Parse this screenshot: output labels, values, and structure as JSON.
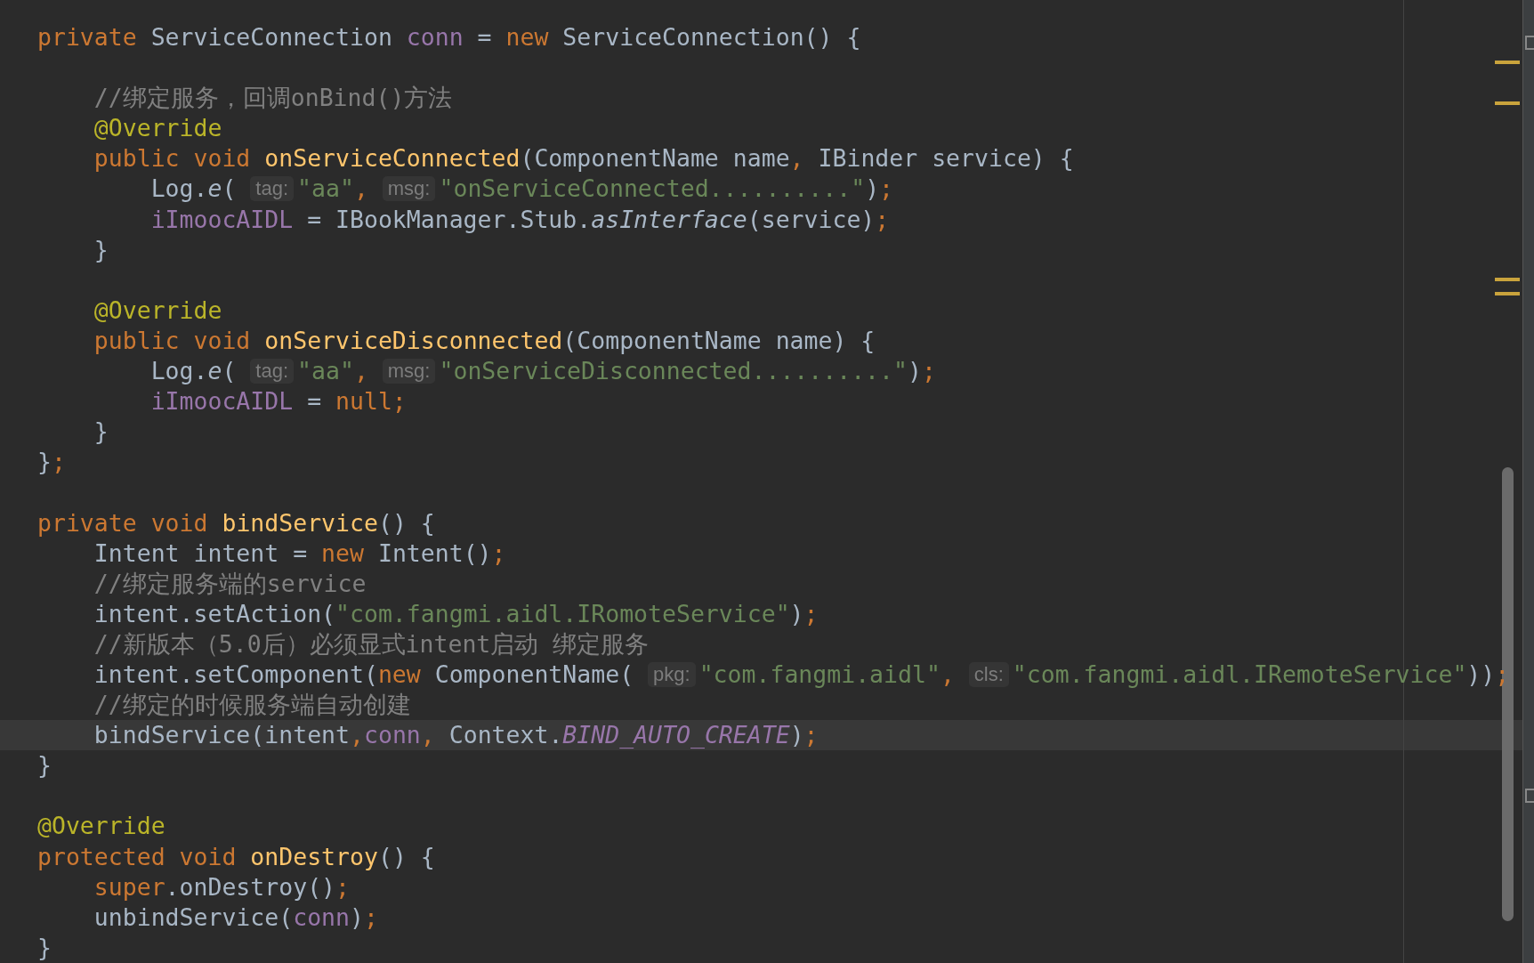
{
  "editor": {
    "lines": [
      {
        "kind": "code",
        "current": false,
        "tokens": [
          {
            "kind": "keyword",
            "text": "private "
          },
          {
            "kind": "plain",
            "text": "ServiceConnection "
          },
          {
            "kind": "field",
            "text": "conn"
          },
          {
            "kind": "plain",
            "text": " = "
          },
          {
            "kind": "keyword",
            "text": "new "
          },
          {
            "kind": "plain",
            "text": "ServiceConnection() {"
          }
        ],
        "children": [
          {
            "kind": "blank"
          },
          {
            "kind": "code",
            "current": false,
            "tokens": [
              {
                "kind": "comment",
                "text": "//绑定服务，回调onBind()方法"
              }
            ]
          },
          {
            "kind": "code",
            "current": false,
            "tokens": [
              {
                "kind": "annotation",
                "text": "@Override"
              }
            ]
          },
          {
            "kind": "code",
            "current": false,
            "tokens": [
              {
                "kind": "keyword",
                "text": "public void "
              },
              {
                "kind": "method",
                "text": "onServiceConnected"
              },
              {
                "kind": "plain",
                "text": "(ComponentName name"
              },
              {
                "kind": "keyword",
                "text": ", "
              },
              {
                "kind": "plain",
                "text": "IBinder service) {"
              }
            ],
            "children": [
              {
                "kind": "code",
                "current": false,
                "tokens": [
                  {
                    "kind": "plain",
                    "text": "Log."
                  },
                  {
                    "kind": "italic",
                    "text": "e"
                  },
                  {
                    "kind": "plain",
                    "text": "( "
                  },
                  {
                    "kind": "hint",
                    "text": "tag:"
                  },
                  {
                    "kind": "string",
                    "text": "\"aa\""
                  },
                  {
                    "kind": "keyword",
                    "text": ", "
                  },
                  {
                    "kind": "hint",
                    "text": "msg:"
                  },
                  {
                    "kind": "string",
                    "text": "\"onServiceConnected..........\""
                  },
                  {
                    "kind": "plain",
                    "text": ")"
                  },
                  {
                    "kind": "keyword",
                    "text": ";"
                  }
                ]
              },
              {
                "kind": "code",
                "current": false,
                "tokens": [
                  {
                    "kind": "field",
                    "text": "iImoocAIDL"
                  },
                  {
                    "kind": "plain",
                    "text": " = IBookManager.Stub."
                  },
                  {
                    "kind": "italic",
                    "text": "asInterface"
                  },
                  {
                    "kind": "plain",
                    "text": "(service)"
                  },
                  {
                    "kind": "keyword",
                    "text": ";"
                  }
                ]
              }
            ]
          },
          {
            "kind": "code",
            "current": false,
            "tokens": [
              {
                "kind": "plain",
                "text": "}"
              }
            ]
          },
          {
            "kind": "blank"
          },
          {
            "kind": "code",
            "current": false,
            "tokens": [
              {
                "kind": "annotation",
                "text": "@Override"
              }
            ]
          },
          {
            "kind": "code",
            "current": false,
            "tokens": [
              {
                "kind": "keyword",
                "text": "public void "
              },
              {
                "kind": "method",
                "text": "onServiceDisconnected"
              },
              {
                "kind": "plain",
                "text": "(ComponentName name) {"
              }
            ],
            "children": [
              {
                "kind": "code",
                "current": false,
                "tokens": [
                  {
                    "kind": "plain",
                    "text": "Log."
                  },
                  {
                    "kind": "italic",
                    "text": "e"
                  },
                  {
                    "kind": "plain",
                    "text": "( "
                  },
                  {
                    "kind": "hint",
                    "text": "tag:"
                  },
                  {
                    "kind": "string",
                    "text": "\"aa\""
                  },
                  {
                    "kind": "keyword",
                    "text": ", "
                  },
                  {
                    "kind": "hint",
                    "text": "msg:"
                  },
                  {
                    "kind": "string",
                    "text": "\"onServiceDisconnected..........\""
                  },
                  {
                    "kind": "plain",
                    "text": ")"
                  },
                  {
                    "kind": "keyword",
                    "text": ";"
                  }
                ]
              },
              {
                "kind": "code",
                "current": false,
                "tokens": [
                  {
                    "kind": "field",
                    "text": "iImoocAIDL"
                  },
                  {
                    "kind": "plain",
                    "text": " = "
                  },
                  {
                    "kind": "keyword",
                    "text": "null;"
                  }
                ]
              }
            ]
          },
          {
            "kind": "code",
            "current": false,
            "tokens": [
              {
                "kind": "plain",
                "text": "}"
              }
            ]
          }
        ]
      },
      {
        "kind": "code",
        "current": false,
        "tokens": [
          {
            "kind": "plain",
            "text": "}"
          },
          {
            "kind": "keyword",
            "text": ";"
          }
        ]
      },
      {
        "kind": "blank"
      },
      {
        "kind": "code",
        "current": false,
        "tokens": [
          {
            "kind": "keyword",
            "text": "private void "
          },
          {
            "kind": "method",
            "text": "bindService"
          },
          {
            "kind": "plain",
            "text": "() {"
          }
        ],
        "children": [
          {
            "kind": "code",
            "current": false,
            "tokens": [
              {
                "kind": "plain",
                "text": "Intent intent = "
              },
              {
                "kind": "keyword",
                "text": "new "
              },
              {
                "kind": "plain",
                "text": "Intent()"
              },
              {
                "kind": "keyword",
                "text": ";"
              }
            ]
          },
          {
            "kind": "code",
            "current": false,
            "tokens": [
              {
                "kind": "comment",
                "text": "//绑定服务端的service"
              }
            ]
          },
          {
            "kind": "code",
            "current": false,
            "tokens": [
              {
                "kind": "plain",
                "text": "intent.setAction("
              },
              {
                "kind": "string",
                "text": "\"com.fangmi.aidl.IRomoteService\""
              },
              {
                "kind": "plain",
                "text": ")"
              },
              {
                "kind": "keyword",
                "text": ";"
              }
            ]
          },
          {
            "kind": "code",
            "current": false,
            "tokens": [
              {
                "kind": "comment",
                "text": "//新版本（5.0后）必须显式intent启动 绑定服务"
              }
            ]
          },
          {
            "kind": "code",
            "current": false,
            "tokens": [
              {
                "kind": "plain",
                "text": "intent.setComponent("
              },
              {
                "kind": "keyword",
                "text": "new "
              },
              {
                "kind": "plain",
                "text": "ComponentName( "
              },
              {
                "kind": "hint",
                "text": "pkg:"
              },
              {
                "kind": "string",
                "text": "\"com.fangmi.aidl\""
              },
              {
                "kind": "keyword",
                "text": ", "
              },
              {
                "kind": "hint",
                "text": "cls:"
              },
              {
                "kind": "string",
                "text": "\"com.fangmi.aidl.IRemoteService\""
              },
              {
                "kind": "plain",
                "text": "))"
              },
              {
                "kind": "keyword",
                "text": ";"
              }
            ]
          },
          {
            "kind": "code",
            "current": false,
            "tokens": [
              {
                "kind": "comment",
                "text": "//绑定的时候服务端自动创建"
              }
            ]
          },
          {
            "kind": "code",
            "current": true,
            "tokens": [
              {
                "kind": "plain",
                "text": "bindService(intent"
              },
              {
                "kind": "keyword",
                "text": ","
              },
              {
                "kind": "field",
                "text": "conn"
              },
              {
                "kind": "keyword",
                "text": ", "
              },
              {
                "kind": "plain",
                "text": "Context."
              },
              {
                "kind": "constant",
                "text": "BIND_AUTO_CREATE"
              },
              {
                "kind": "plain",
                "text": ")"
              },
              {
                "kind": "keyword",
                "text": ";"
              }
            ]
          }
        ]
      },
      {
        "kind": "code",
        "current": false,
        "tokens": [
          {
            "kind": "plain",
            "text": "}"
          }
        ]
      },
      {
        "kind": "blank"
      },
      {
        "kind": "code",
        "current": false,
        "tokens": [
          {
            "kind": "annotation",
            "text": "@Override"
          }
        ]
      },
      {
        "kind": "code",
        "current": false,
        "tokens": [
          {
            "kind": "keyword",
            "text": "protected void "
          },
          {
            "kind": "method",
            "text": "onDestroy"
          },
          {
            "kind": "plain",
            "text": "() {"
          }
        ],
        "children": [
          {
            "kind": "code",
            "current": false,
            "tokens": [
              {
                "kind": "keyword",
                "text": "super"
              },
              {
                "kind": "plain",
                "text": ".onDestroy()"
              },
              {
                "kind": "keyword",
                "text": ";"
              }
            ]
          },
          {
            "kind": "code",
            "current": false,
            "tokens": [
              {
                "kind": "plain",
                "text": "unbindService("
              },
              {
                "kind": "field",
                "text": "conn"
              },
              {
                "kind": "plain",
                "text": ")"
              },
              {
                "kind": "keyword",
                "text": ";"
              }
            ]
          }
        ]
      },
      {
        "kind": "code",
        "current": false,
        "tokens": [
          {
            "kind": "plain",
            "text": "}"
          }
        ]
      }
    ]
  }
}
